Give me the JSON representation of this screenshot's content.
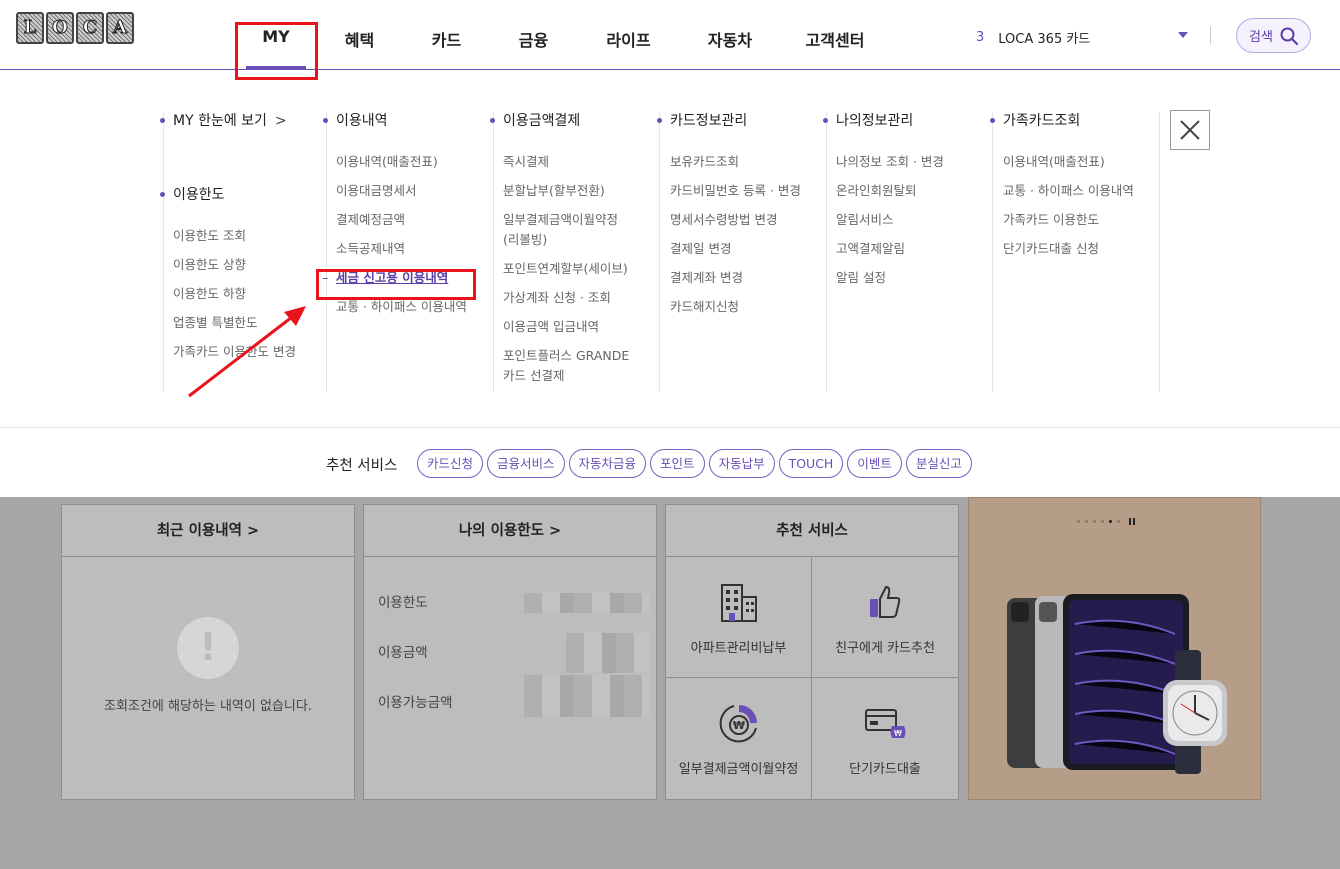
{
  "header": {
    "logo_letters": [
      "L",
      "O",
      "C",
      "A"
    ],
    "nav": [
      {
        "label": "MY",
        "active": true
      },
      {
        "label": "혜택"
      },
      {
        "label": "카드"
      },
      {
        "label": "금융"
      },
      {
        "label": "라이프"
      },
      {
        "label": "자동차"
      },
      {
        "label": "고객센터"
      }
    ],
    "card_count": "3",
    "card_name": "LOCA 365 카드",
    "search_label": "검색"
  },
  "menu": {
    "col1": {
      "title": "MY 한눈에 보기",
      "title_arrow": ">",
      "sub_title": "이용한도",
      "items": [
        "이용한도 조회",
        "이용한도 상향",
        "이용한도 하향",
        "업종별 특별한도",
        "가족카드 이용한도 변경"
      ]
    },
    "col2": {
      "title": "이용내역",
      "items": [
        "이용내역(매출전표)",
        "이용대금명세서",
        "결제예정금액",
        "소득공제내역",
        "세금 신고용 이용내역",
        "교통 · 하이패스 이용내역"
      ]
    },
    "col3": {
      "title": "이용금액결제",
      "items": [
        "즉시결제",
        "분할납부(할부전환)",
        "일부결제금액이월약정(리볼빙)",
        "포인트연계할부(세이브)",
        "가상계좌 신청 · 조회",
        "이용금액 입금내역",
        "포인트플러스 GRANDE카드 선결제"
      ]
    },
    "col4": {
      "title": "카드정보관리",
      "items": [
        "보유카드조회",
        "카드비밀번호 등록 · 변경",
        "명세서수령방법 변경",
        "결제일 변경",
        "결제계좌 변경",
        "카드해지신청"
      ]
    },
    "col5": {
      "title": "나의정보관리",
      "items": [
        "나의정보 조회 · 변경",
        "온라인회원탈퇴",
        "알림서비스",
        "고액결제알림",
        "알림 설정"
      ]
    },
    "col6": {
      "title": "가족카드조회",
      "items": [
        "이용내역(매출전표)",
        "교통 · 하이패스 이용내역",
        "가족카드 이용한도",
        "단기카드대출 신청"
      ]
    },
    "highlighted_item": "세금 신고용 이용내역"
  },
  "recommend": {
    "label": "추천 서비스",
    "chips": [
      "카드신청",
      "금융서비스",
      "자동차금융",
      "포인트",
      "자동납부",
      "TOUCH",
      "이벤트",
      "분실신고"
    ]
  },
  "panels": {
    "recent": {
      "title": "최근 이용내역 >",
      "empty_icon": "!",
      "empty_text": "조회조건에 해당하는 내역이 없습니다."
    },
    "limit": {
      "title": "나의 이용한도 >",
      "rows": [
        "이용한도",
        "이용금액",
        "이용가능금액"
      ]
    },
    "services": {
      "title": "추천 서비스",
      "items": [
        {
          "label": "아파트관리비납부",
          "icon": "building-icon"
        },
        {
          "label": "친구에게 카드추천",
          "icon": "thumbs-up-icon"
        },
        {
          "label": "일부결제금액이월약정",
          "icon": "won-cycle-icon"
        },
        {
          "label": "단기카드대출",
          "icon": "card-money-icon"
        }
      ]
    },
    "promo": {
      "slide_count": 6,
      "active_slide": 5
    }
  },
  "colors": {
    "accent": "#6b4fb8",
    "annotation": "#e8131b",
    "overlay": "#a6a6a8"
  }
}
